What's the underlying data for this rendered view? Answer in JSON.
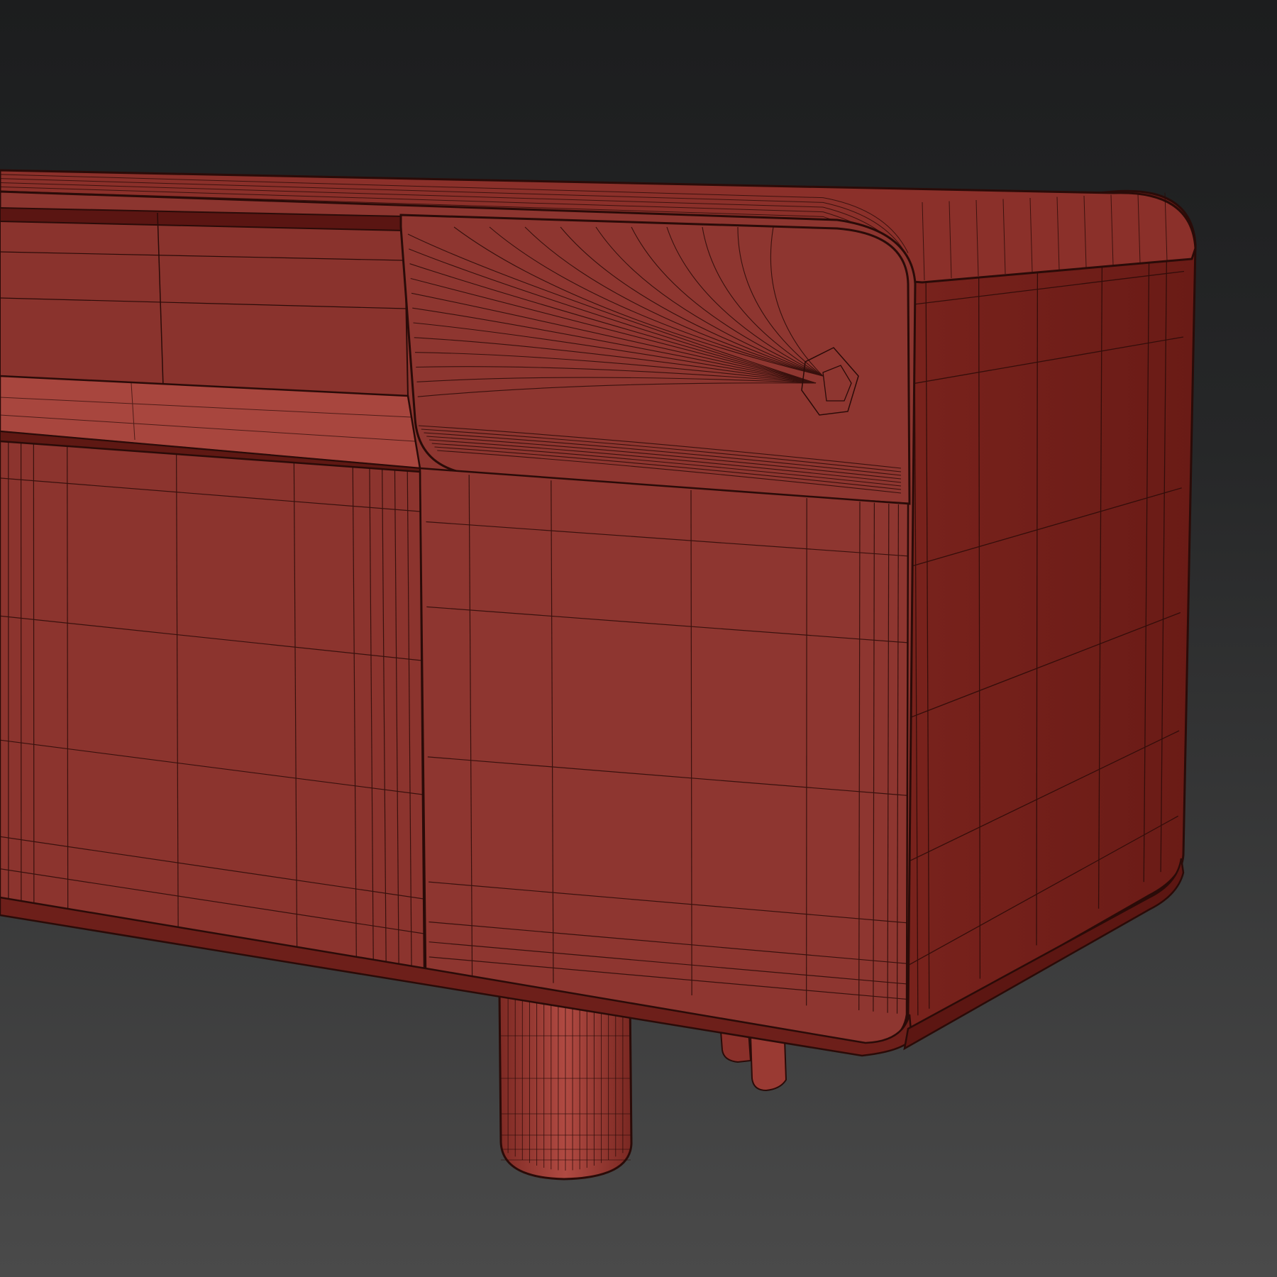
{
  "scene": {
    "subject": "sideboard-wireframe-render",
    "colors": {
      "background_top": "#1c1d1e",
      "background_bottom": "#4a4a4a",
      "face_front": "#8d352f",
      "face_front_light": "#a04a42",
      "face_side": "#6f1d18",
      "face_top": "#8a2f2a",
      "shelf": "#a8463e",
      "wire": "#2a0b08",
      "leg": "#a04038"
    }
  }
}
